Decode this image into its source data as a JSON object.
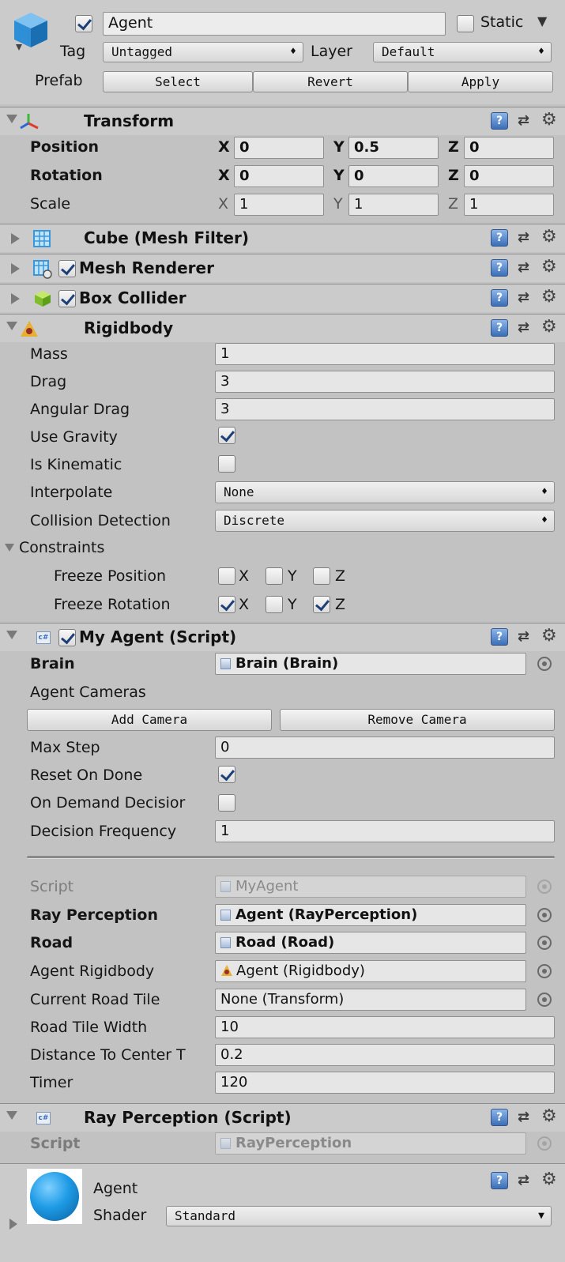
{
  "gameobject": {
    "name": "Agent",
    "active": true,
    "static_label": "Static",
    "static": false,
    "tag_label": "Tag",
    "tag_value": "Untagged",
    "layer_label": "Layer",
    "layer_value": "Default",
    "prefab_label": "Prefab",
    "prefab_buttons": [
      "Select",
      "Revert",
      "Apply"
    ]
  },
  "transform": {
    "title": "Transform",
    "position_label": "Position",
    "rotation_label": "Rotation",
    "scale_label": "Scale",
    "axes": [
      "X",
      "Y",
      "Z"
    ],
    "position": [
      "0",
      "0.5",
      "0"
    ],
    "rotation": [
      "0",
      "0",
      "0"
    ],
    "scale": [
      "1",
      "1",
      "1"
    ]
  },
  "components_collapsed": [
    {
      "title": "Cube (Mesh Filter)",
      "has_checkbox": false
    },
    {
      "title": "Mesh Renderer",
      "has_checkbox": true,
      "enabled": true
    },
    {
      "title": "Box Collider",
      "has_checkbox": true,
      "enabled": true
    }
  ],
  "rigidbody": {
    "title": "Rigidbody",
    "mass_label": "Mass",
    "mass": "1",
    "drag_label": "Drag",
    "drag": "3",
    "angular_drag_label": "Angular Drag",
    "angular_drag": "3",
    "use_gravity_label": "Use Gravity",
    "use_gravity": true,
    "is_kinematic_label": "Is Kinematic",
    "is_kinematic": false,
    "interpolate_label": "Interpolate",
    "interpolate": "None",
    "collision_label": "Collision Detection",
    "collision": "Discrete",
    "constraints_label": "Constraints",
    "freeze_position_label": "Freeze Position",
    "freeze_rotation_label": "Freeze Rotation",
    "axes": [
      "X",
      "Y",
      "Z"
    ],
    "freeze_position": [
      false,
      false,
      false
    ],
    "freeze_rotation": [
      true,
      false,
      true
    ]
  },
  "my_agent": {
    "title": "My Agent (Script)",
    "enabled": true,
    "brain_label": "Brain",
    "brain": "Brain (Brain)",
    "agent_cameras_label": "Agent Cameras",
    "add_camera": "Add Camera",
    "remove_camera": "Remove Camera",
    "max_step_label": "Max Step",
    "max_step": "0",
    "reset_on_done_label": "Reset On Done",
    "reset_on_done": true,
    "on_demand_label": "On Demand Decisior",
    "on_demand": false,
    "decision_freq_label": "Decision Frequency",
    "decision_freq": "1",
    "script_label": "Script",
    "script": "MyAgent",
    "ray_label": "Ray Perception",
    "ray": "Agent (RayPerception)",
    "road_label": "Road",
    "road": "Road (Road)",
    "rigidbody_label": "Agent Rigidbody",
    "rigidbody": "Agent (Rigidbody)",
    "tile_label": "Current Road Tile",
    "tile": "None (Transform)",
    "tile_width_label": "Road Tile Width",
    "tile_width": "10",
    "distance_label": "Distance To Center T",
    "distance": "0.2",
    "timer_label": "Timer",
    "timer": "120"
  },
  "ray_perception": {
    "title": "Ray Perception (Script)",
    "script_label": "Script",
    "script": "RayPerception"
  },
  "material": {
    "name": "Agent",
    "shader_label": "Shader",
    "shader": "Standard"
  },
  "colors": {
    "panel_bg": "#c2c2c2",
    "header_bg": "#cbcbcb",
    "accent_blue": "#3a6fb8"
  }
}
